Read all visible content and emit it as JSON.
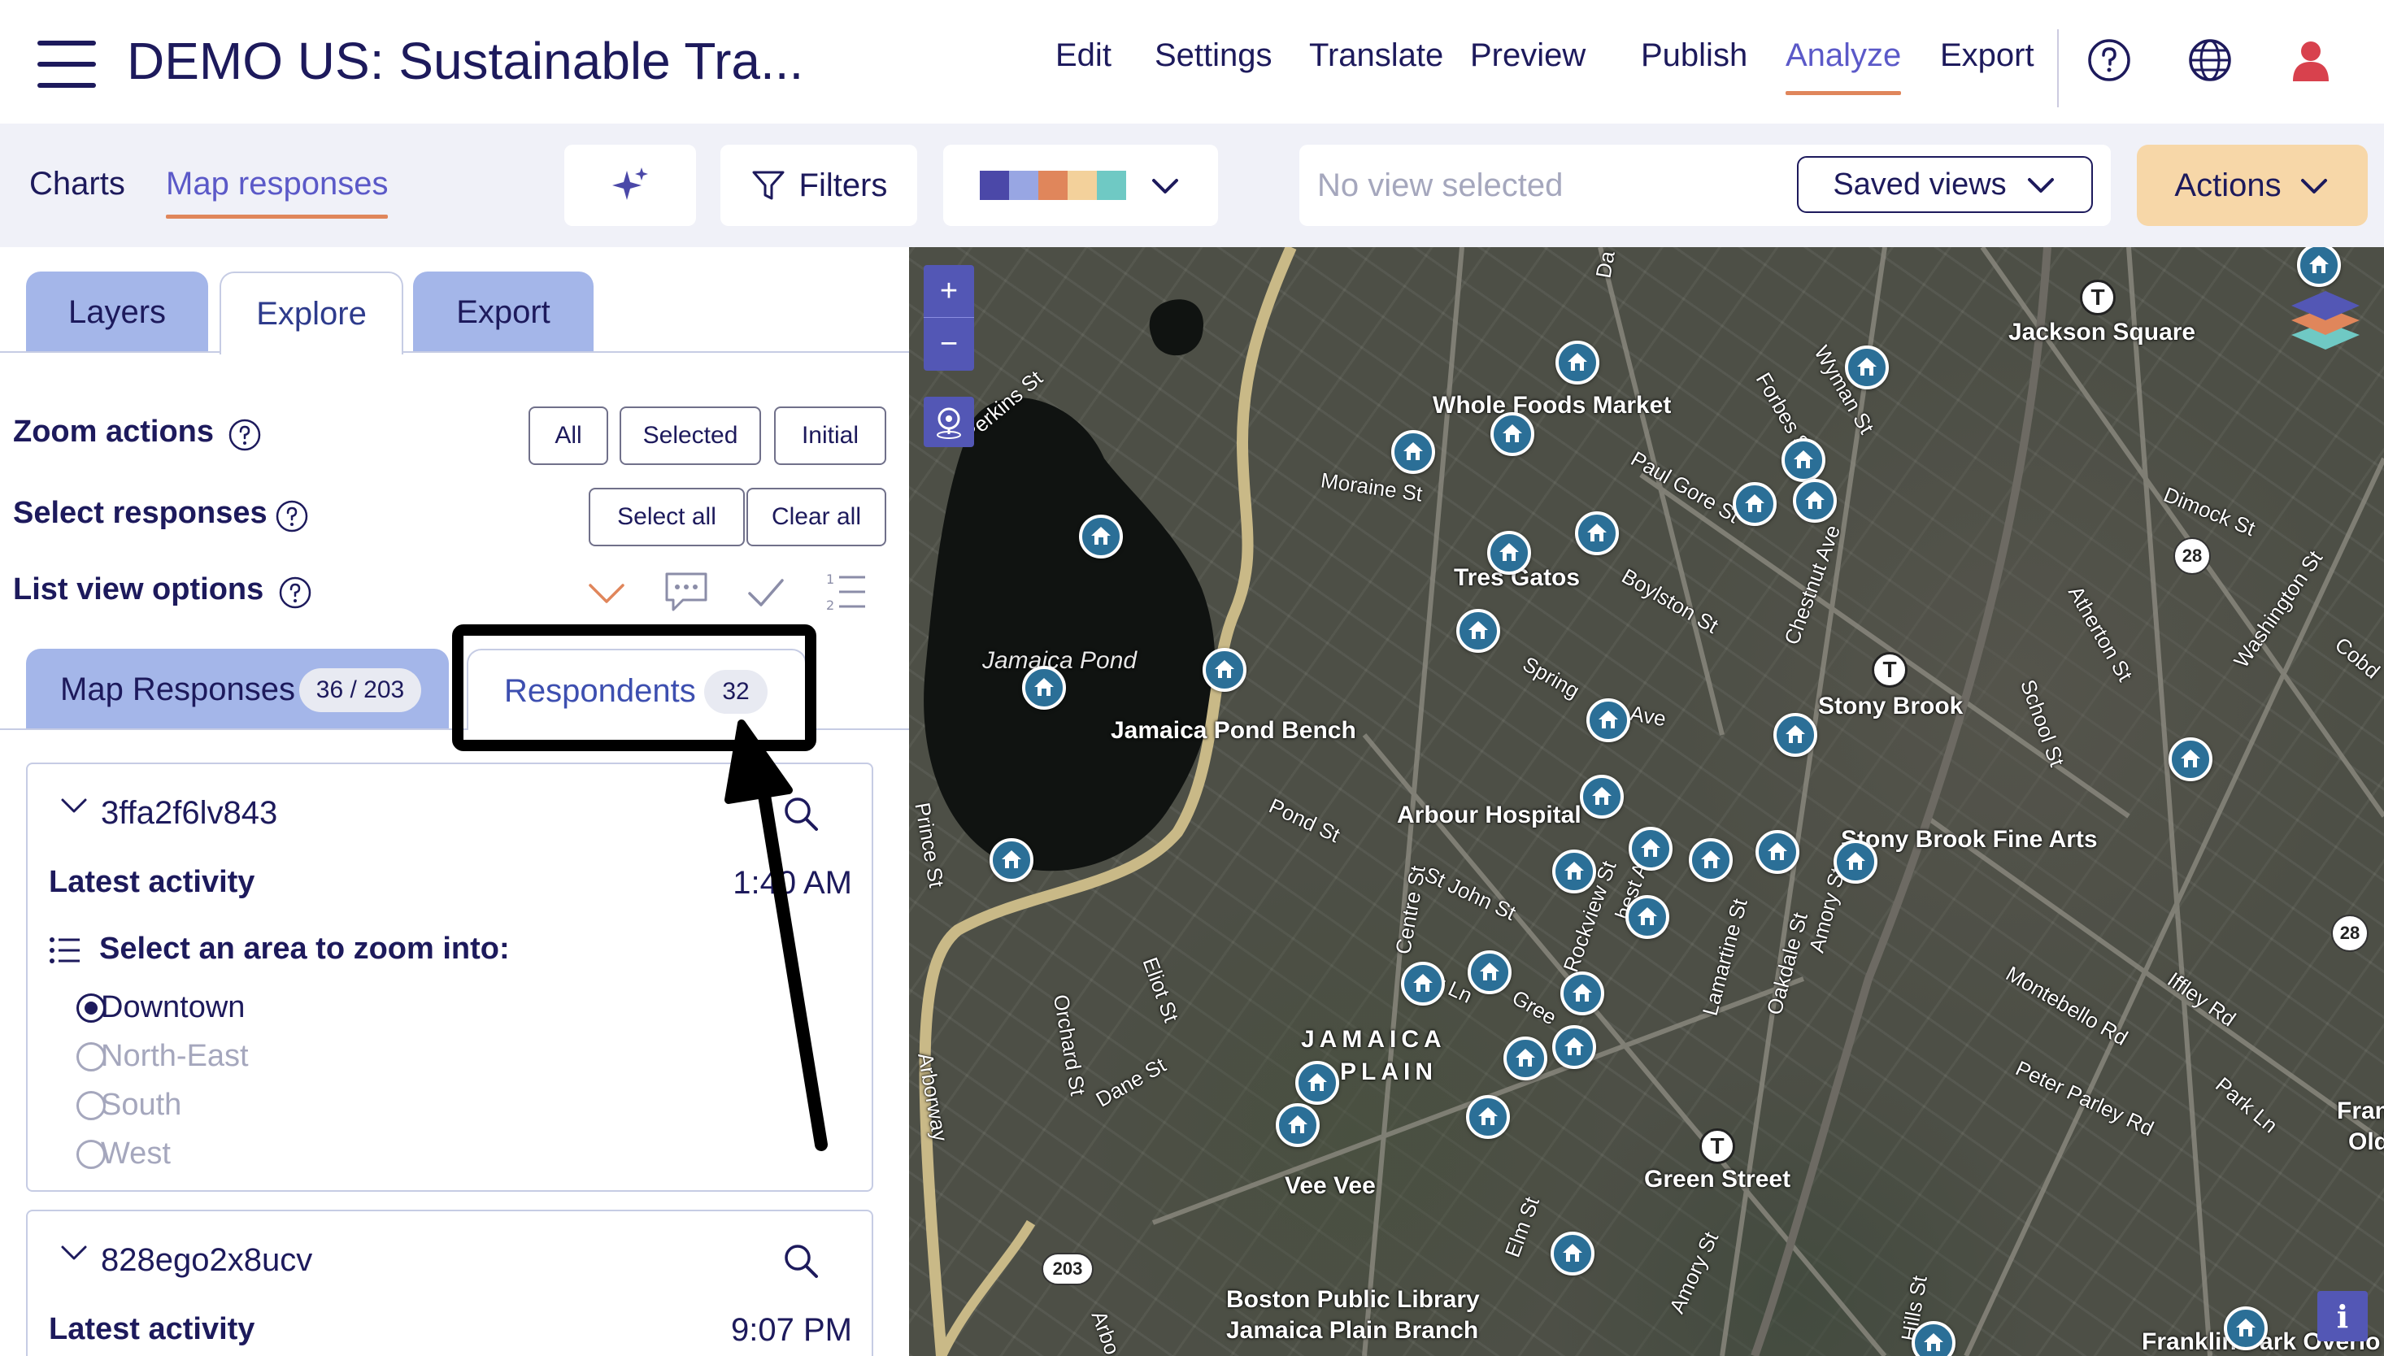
{
  "header": {
    "title": "DEMO US: Sustainable Tra...",
    "nav": [
      {
        "label": "Edit"
      },
      {
        "label": "Settings"
      },
      {
        "label": "Translate"
      },
      {
        "label": "Preview"
      },
      {
        "label": "Publish"
      },
      {
        "label": "Analyze",
        "active": true
      },
      {
        "label": "Export"
      }
    ],
    "icons": [
      "help-icon",
      "globe-icon",
      "user-icon"
    ]
  },
  "toolbar": {
    "tabs": [
      {
        "label": "Charts"
      },
      {
        "label": "Map responses",
        "active": true
      }
    ],
    "ai_icon": "sparkles-icon",
    "filters_label": "Filters",
    "palette_colors": [
      "#4b48a8",
      "#98a6e3",
      "#e0865b",
      "#f3d19b",
      "#6fc9c4"
    ],
    "view_placeholder": "No view selected",
    "saved_views_label": "Saved views",
    "actions_label": "Actions"
  },
  "panel": {
    "tabs": [
      {
        "label": "Layers"
      },
      {
        "label": "Explore",
        "active": true
      },
      {
        "label": "Export"
      }
    ],
    "zoom_actions": {
      "label": "Zoom actions",
      "buttons": [
        "All",
        "Selected",
        "Initial"
      ]
    },
    "select_responses": {
      "label": "Select responses",
      "buttons": [
        "Select all",
        "Clear all"
      ]
    },
    "list_view_options": {
      "label": "List view options",
      "icons": [
        "chevron-down-icon",
        "comment-icon",
        "check-icon",
        "numbered-list-icon"
      ]
    },
    "result_tabs": {
      "map_responses": {
        "label": "Map Responses",
        "count": "36 / 203"
      },
      "respondents": {
        "label": "Respondents",
        "count": "32"
      }
    },
    "cards": [
      {
        "id": "3ffa2f6lv843",
        "latest_label": "Latest activity",
        "latest_time": "1:40 AM",
        "question": "Select an area to zoom into:",
        "options": [
          {
            "label": "Downtown",
            "selected": true
          },
          {
            "label": "North-East",
            "selected": false
          },
          {
            "label": "South",
            "selected": false
          },
          {
            "label": "West",
            "selected": false
          }
        ]
      },
      {
        "id": "828ego2x8ucv",
        "latest_label": "Latest activity",
        "latest_time": "9:07 PM"
      }
    ]
  },
  "map": {
    "zoom_in": "+",
    "zoom_out": "−",
    "info": "i",
    "labels": {
      "jackson_square": "Jackson Square",
      "whole_foods": "Whole Foods Market",
      "perkins": "Perkins St",
      "moraine": "Moraine St",
      "paul_gore": "Paul Gore St",
      "dimock": "Dimock St",
      "tres_gatos": "Tres Gatos",
      "boylston": "Boylston St",
      "jamaica_pond": "Jamaica Pond",
      "jamaica_pond_bench": "Jamaica Pond Bench",
      "stony_brook": "Stony Brook",
      "spring": "Spring",
      "k_ave": "k Ave",
      "arbour": "Arbour Hospital",
      "pond_st": "Pond St",
      "stony_brook_fine_arts": "Stony Brook Fine Arts",
      "st_john": "St John St",
      "jamaica": "JAMAICA",
      "plain": "PLAIN",
      "vee_vee": "Vee Vee",
      "green_street": "Green Street",
      "bpl1": "Boston Public Library",
      "bpl2": "Jamaica Plain Branch",
      "franklin_park": "Franklin Park Overlo",
      "frank": "Frank",
      "old": "Old",
      "centre": "Centre St",
      "orchard": "Orchard St",
      "eliot": "Eliot St",
      "dane": "Dane St",
      "arborway": "Arborway",
      "arbo": "Arbo",
      "elm": "Elm St",
      "amory": "Amory St",
      "amory2": "Amory St",
      "hills": "Hills St",
      "oakdale": "Oakdale St",
      "lamartine": "Lamartine St",
      "chestnut": "Chestnut Ave",
      "forbes": "Forbes St",
      "wyman": "Wyman St",
      "school": "School St",
      "atherton": "Atherton St",
      "washington": "Washington St",
      "cobd": "Cobd",
      "montebello": "Montebello Rd",
      "iffley": "Iffley Rd",
      "peter_parley": "Peter Parley Rd",
      "park_ln": "Park Ln",
      "rockview": "Rockview St",
      "chest_ave": "hest Ave",
      "gree": "Gree",
      "rr_ln": "rr Ln",
      "pri": "Prince St",
      "da": "Da"
    },
    "routes": [
      "28",
      "28",
      "203"
    ],
    "transit_marker": "T"
  }
}
